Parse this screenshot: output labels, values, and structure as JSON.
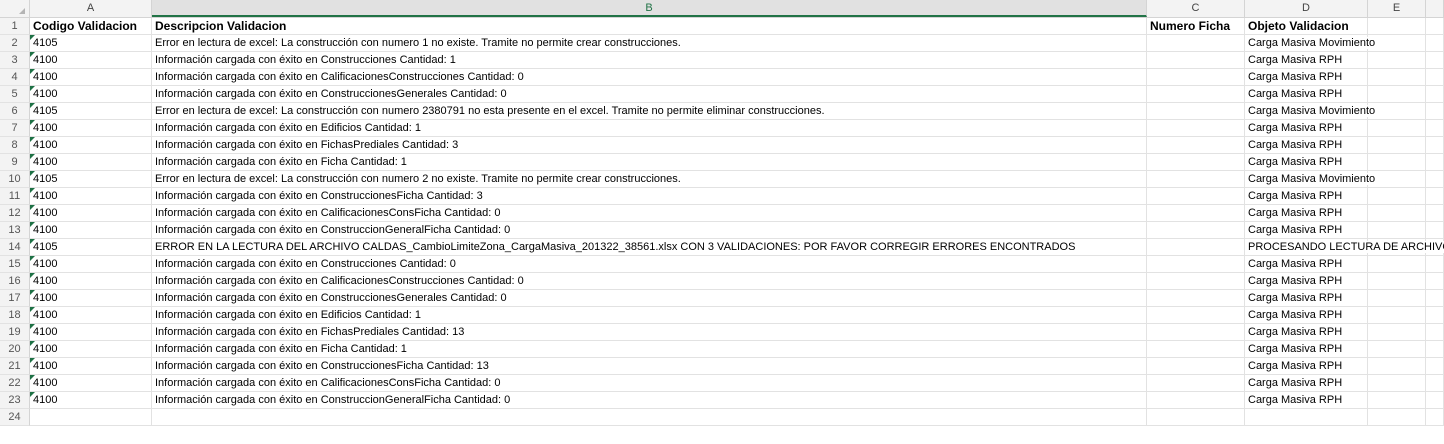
{
  "columns": [
    "A",
    "B",
    "C",
    "D",
    "E"
  ],
  "headers": {
    "a": "Codigo Validacion",
    "b": "Descripcion Validacion",
    "c": "Numero Ficha",
    "d": "Objeto Validacion"
  },
  "rows": [
    {
      "n": "2",
      "a": "4105",
      "b": "Error en lectura de excel: La construcción con numero 1 no existe. Tramite no permite crear construcciones.",
      "d": "Carga Masiva Movimiento"
    },
    {
      "n": "3",
      "a": "4100",
      "b": "Información cargada con éxito en Construcciones Cantidad: 1",
      "d": "Carga Masiva RPH"
    },
    {
      "n": "4",
      "a": "4100",
      "b": "Información cargada con éxito en CalificacionesConstrucciones Cantidad: 0",
      "d": "Carga Masiva RPH"
    },
    {
      "n": "5",
      "a": "4100",
      "b": "Información cargada con éxito en ConstruccionesGenerales Cantidad: 0",
      "d": "Carga Masiva RPH"
    },
    {
      "n": "6",
      "a": "4105",
      "b": "Error en lectura de excel: La construcción con numero 2380791 no esta presente en el excel. Tramite no permite eliminar construcciones.",
      "d": "Carga Masiva Movimiento"
    },
    {
      "n": "7",
      "a": "4100",
      "b": "Información cargada con éxito en Edificios Cantidad: 1",
      "d": "Carga Masiva RPH"
    },
    {
      "n": "8",
      "a": "4100",
      "b": "Información cargada con éxito en FichasPrediales Cantidad: 3",
      "d": "Carga Masiva RPH"
    },
    {
      "n": "9",
      "a": "4100",
      "b": "Información cargada con éxito en Ficha Cantidad: 1",
      "d": "Carga Masiva RPH"
    },
    {
      "n": "10",
      "a": "4105",
      "b": "Error en lectura de excel: La construcción con numero 2 no existe. Tramite no permite crear construcciones.",
      "d": "Carga Masiva Movimiento"
    },
    {
      "n": "11",
      "a": "4100",
      "b": "Información cargada con éxito en ConstruccionesFicha Cantidad: 3",
      "d": "Carga Masiva RPH"
    },
    {
      "n": "12",
      "a": "4100",
      "b": "Información cargada con éxito en CalificacionesConsFicha Cantidad: 0",
      "d": "Carga Masiva RPH"
    },
    {
      "n": "13",
      "a": "4100",
      "b": "Información cargada con éxito en ConstruccionGeneralFicha Cantidad: 0",
      "d": "Carga Masiva RPH"
    },
    {
      "n": "14",
      "a": "4105",
      "b": "ERROR EN LA LECTURA DEL ARCHIVO CALDAS_CambioLimiteZona_CargaMasiva_201322_38561.xlsx CON 3 VALIDACIONES: POR FAVOR CORREGIR ERRORES ENCONTRADOS",
      "d": "PROCESANDO LECTURA DE ARCHIVO I"
    },
    {
      "n": "15",
      "a": "4100",
      "b": "Información cargada con éxito en Construcciones Cantidad: 0",
      "d": "Carga Masiva RPH"
    },
    {
      "n": "16",
      "a": "4100",
      "b": "Información cargada con éxito en CalificacionesConstrucciones Cantidad: 0",
      "d": "Carga Masiva RPH"
    },
    {
      "n": "17",
      "a": "4100",
      "b": "Información cargada con éxito en ConstruccionesGenerales Cantidad: 0",
      "d": "Carga Masiva RPH"
    },
    {
      "n": "18",
      "a": "4100",
      "b": "Información cargada con éxito en Edificios Cantidad: 1",
      "d": "Carga Masiva RPH"
    },
    {
      "n": "19",
      "a": "4100",
      "b": "Información cargada con éxito en FichasPrediales Cantidad: 13",
      "d": "Carga Masiva RPH"
    },
    {
      "n": "20",
      "a": "4100",
      "b": "Información cargada con éxito en Ficha Cantidad: 1",
      "d": "Carga Masiva RPH"
    },
    {
      "n": "21",
      "a": "4100",
      "b": "Información cargada con éxito en ConstruccionesFicha Cantidad: 13",
      "d": "Carga Masiva RPH"
    },
    {
      "n": "22",
      "a": "4100",
      "b": "Información cargada con éxito en CalificacionesConsFicha Cantidad: 0",
      "d": "Carga Masiva RPH"
    },
    {
      "n": "23",
      "a": "4100",
      "b": "Información cargada con éxito en ConstruccionGeneralFicha Cantidad: 0",
      "d": "Carga Masiva RPH"
    }
  ],
  "row_numbers": {
    "header": "1",
    "last": "24"
  },
  "selected_column": "B",
  "accent_color": "#217346",
  "error_indicator_color": "#1e7145"
}
